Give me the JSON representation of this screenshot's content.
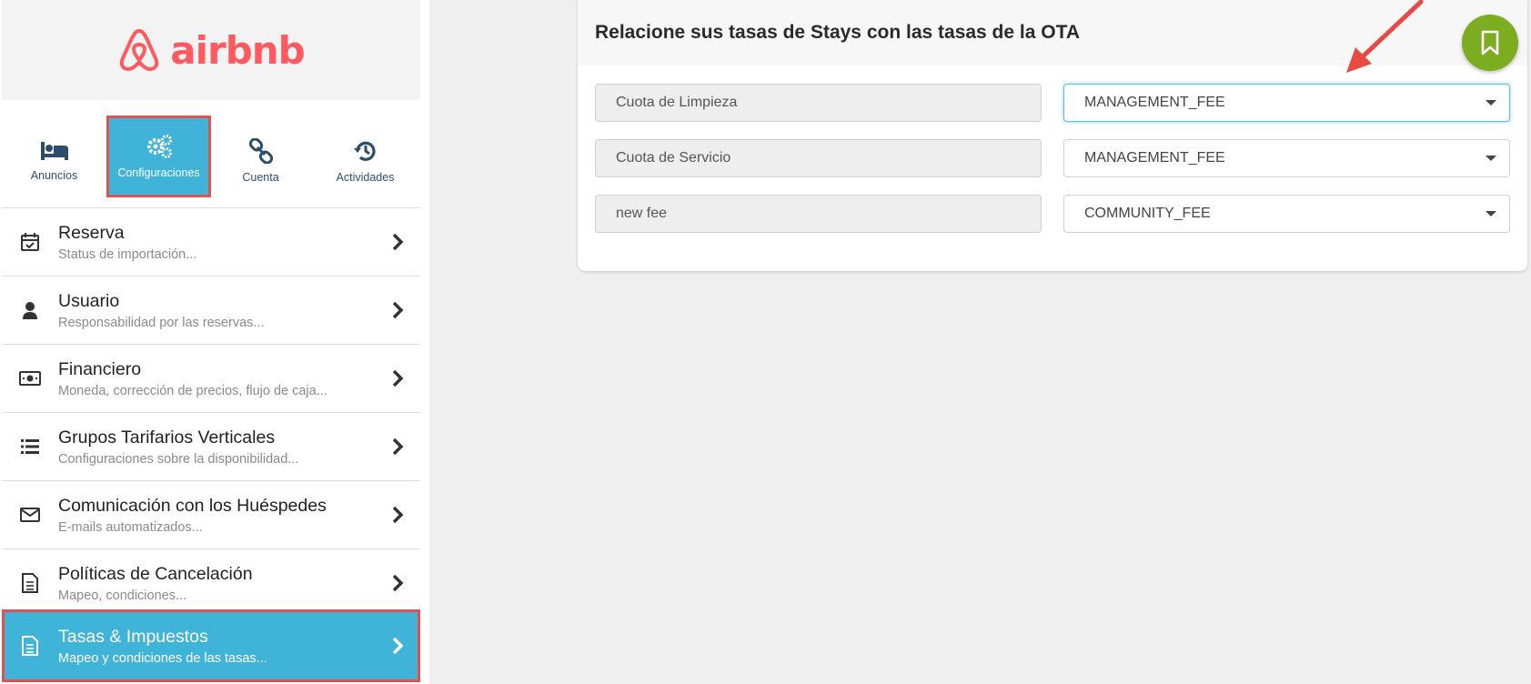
{
  "brand": {
    "name": "airbnb",
    "color": "#ff5a5f"
  },
  "top_tabs": [
    {
      "label": "Anuncios",
      "icon": "bed-icon"
    },
    {
      "label": "Configuraciones",
      "icon": "gears-icon"
    },
    {
      "label": "Cuenta",
      "icon": "link-icon"
    },
    {
      "label": "Actividades",
      "icon": "history-icon"
    }
  ],
  "menu": [
    {
      "title": "Reserva",
      "subtitle": "Status de importación...",
      "icon": "calendar-check-icon"
    },
    {
      "title": "Usuario",
      "subtitle": "Responsabilidad por las reservas...",
      "icon": "user-icon"
    },
    {
      "title": "Financiero",
      "subtitle": "Moneda, corrección de precios, flujo de caja...",
      "icon": "money-bill-icon"
    },
    {
      "title": "Grupos Tarifarios Verticales",
      "subtitle": "Configuraciones sobre la disponibilidad...",
      "icon": "list-icon"
    },
    {
      "title": "Comunicación con los Huéspedes",
      "subtitle": "E-mails automatizados...",
      "icon": "envelope-icon"
    },
    {
      "title": "Políticas de Cancelación",
      "subtitle": "Mapeo, condiciones...",
      "icon": "document-icon"
    },
    {
      "title": "Tasas & Impuestos",
      "subtitle": "Mapeo y condiciones de las tasas...",
      "icon": "document-icon"
    }
  ],
  "card": {
    "title": "Relacione sus tasas de Stays con las tasas de la OTA",
    "rows": [
      {
        "stays_fee": "Cuota de Limpieza",
        "ota_fee": "MANAGEMENT_FEE"
      },
      {
        "stays_fee": "Cuota de Servicio",
        "ota_fee": "MANAGEMENT_FEE"
      },
      {
        "stays_fee": "new fee",
        "ota_fee": "COMMUNITY_FEE"
      }
    ]
  },
  "colors": {
    "accent": "#40b3d8",
    "highlight": "#e05252",
    "fab": "#7cac1f",
    "nav_text": "#2d4e6a"
  }
}
